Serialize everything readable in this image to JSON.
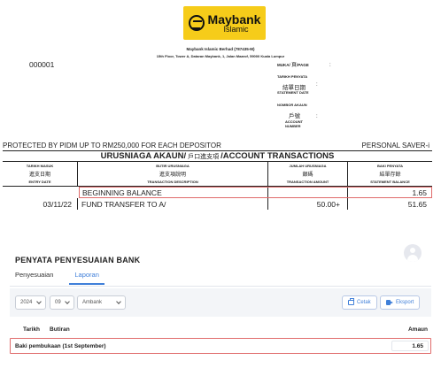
{
  "statement": {
    "logo": {
      "name": "Maybank",
      "sub": "Islamic",
      "color": "#f6cc1a"
    },
    "bank_entity": "Maybank Islamic Berhad (787435-M)",
    "bank_address": "15th Floor, Tower A, Dataran Maybank, 1, Jalan Maarof, 59000 Kuala Lumpur",
    "account_code": "000001",
    "info": {
      "page_label": "MUKA/",
      "page_cn": "頁",
      "page_en": "/PAGE",
      "date_label": "TARIKH PENYATA",
      "date_cn": "結單日期",
      "date_en": "STATEMENT DATE",
      "account_label": "NOMBOR AKAUN",
      "account_cn": "戶號",
      "account_en1": "ACCOUNT",
      "account_en2": "NUMBER",
      "colon": ":"
    },
    "protection_text": "PROTECTED BY PIDM UP TO RM250,000 FOR EACH DEPOSITOR",
    "product": "PERSONAL SAVER-i",
    "table_title_left": "URUSNIAGA AKAUN/",
    "table_title_cn": "戶口進支項",
    "table_title_right": "/ACCOUNT TRANSACTIONS",
    "columns": [
      {
        "ms": "TARIKH MASUK",
        "cn": "進支日期",
        "en": "ENTRY DATE"
      },
      {
        "ms": "BUTIR URUSNIAGA",
        "cn": "進支項說明",
        "en": "TRANSACTION DESCRIPTION"
      },
      {
        "ms": "JUMLAH URUSNIAGA",
        "cn": "銀碼",
        "en": "TRANSACTION AMOUNT"
      },
      {
        "ms": "BAKI PENYATA",
        "cn": "結單存餘",
        "en": "STATEMENT BALANCE"
      }
    ],
    "rows": [
      {
        "date": "",
        "desc": "BEGINNING BALANCE",
        "amount": "",
        "balance": "1.65"
      },
      {
        "date": "03/11/22",
        "desc": "FUND TRANSFER TO A/",
        "amount": "50.00+",
        "balance": "51.65"
      }
    ]
  },
  "app": {
    "title": "PENYATA PENYESUAIAN BANK",
    "tabs": [
      {
        "label": "Penyesuaian",
        "active": false
      },
      {
        "label": "Laporan",
        "active": true
      }
    ],
    "filters": {
      "year": "2024",
      "month": "09",
      "bank": "Ambank"
    },
    "buttons": {
      "print": "Cetak",
      "export": "Eksport"
    },
    "list_headers": {
      "date": "Tarikh",
      "desc": "Butiran",
      "amount": "Amaun"
    },
    "rows": [
      {
        "desc": "Baki pembukaan (1st September)",
        "amount": "1.65"
      }
    ],
    "accent_color": "#3f7fd9",
    "highlight_color": "#e06b6b"
  }
}
